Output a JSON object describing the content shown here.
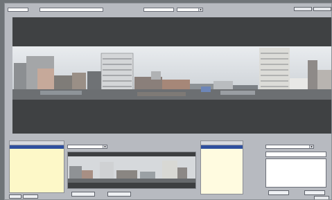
{
  "header": {
    "id_label": "",
    "id_value": "",
    "name_label": "",
    "name_value": "",
    "mid_label": "",
    "mid_value": "",
    "select_value": "",
    "right_label": "",
    "small_top_right": "",
    "buttons": [
      "",
      ""
    ]
  },
  "lower": {
    "left_list": {
      "headers": [
        "",
        "",
        ""
      ],
      "rows": [
        {
          "a": "",
          "b": ""
        },
        {
          "a": "",
          "b": ""
        }
      ]
    },
    "middle": {
      "title": "",
      "select_value": "",
      "buttons": [
        "",
        ""
      ]
    },
    "right_list": {
      "headers": [
        "",
        ""
      ],
      "rows": [
        {
          "a": "",
          "b": ""
        },
        {
          "a": "",
          "b": ""
        }
      ]
    },
    "form": {
      "title": "",
      "type_label": "",
      "type_value": "",
      "group_label": "",
      "extra_label": "",
      "note_label": "",
      "buttons": [
        "",
        ""
      ],
      "corner_button": ""
    },
    "bottom_left_buttons": [
      "",
      ""
    ]
  },
  "colors": {
    "selection": "#2e4f9e",
    "list_bg": "#fdf8c8",
    "viewer_bg": "#3f4143"
  }
}
